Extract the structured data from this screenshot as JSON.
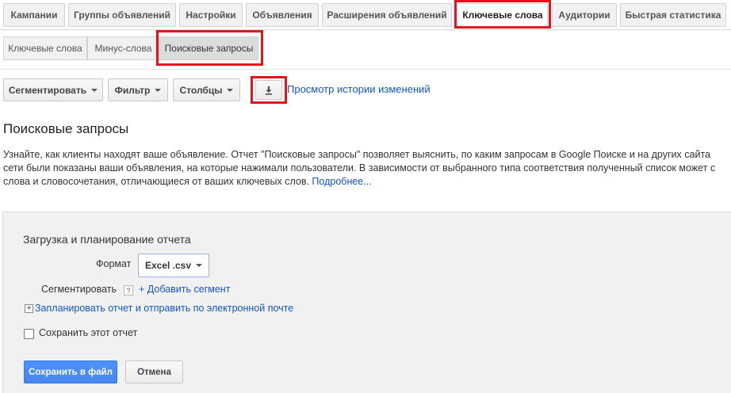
{
  "tabs": [
    {
      "label": "Кампании"
    },
    {
      "label": "Группы объявлений"
    },
    {
      "label": "Настройки"
    },
    {
      "label": "Объявления"
    },
    {
      "label": "Расширения объявлений"
    },
    {
      "label": "Ключевые слова",
      "active": true
    },
    {
      "label": "Аудитории"
    },
    {
      "label": "Быстрая статистика"
    }
  ],
  "subtabs": [
    {
      "label": "Ключевые слова"
    },
    {
      "label": "Минус-слова"
    },
    {
      "label": "Поисковые запросы",
      "active": true
    }
  ],
  "toolbar": {
    "segment_label": "Сегментировать",
    "filter_label": "Фильтр",
    "columns_label": "Столбцы",
    "download_icon": "download-icon",
    "history_link": "Просмотр истории изменений"
  },
  "page": {
    "title": "Поисковые запросы",
    "description_lines": [
      "Узнайте, как клиенты находят ваше объявление. Отчет \"Поисковые запросы\" позволяет выяснить, по каким запросам в Google Поиске и на других сайта",
      "сети были показаны ваши объявления, на которые нажимали пользователи. В зависимости от выбранного типа соответствия полученный список может с",
      "слова и словосочетания, отличающиеся от ваших ключевых слов."
    ],
    "more_link": "Подробнее..."
  },
  "report": {
    "title": "Загрузка и планирование отчета",
    "format_label": "Формат",
    "format_value": "Excel .csv",
    "segment_label": "Сегментировать",
    "help_glyph": "?",
    "add_segment": "+ Добавить сегмент",
    "expand_glyph": "+",
    "schedule_link": "Запланировать отчет и отправить по электронной почте",
    "save_report_label": "Сохранить этот отчет",
    "save_report_checked": false,
    "save_button": "Сохранить в файл",
    "cancel_button": "Отмена"
  },
  "colors": {
    "highlight": "#e4141e",
    "link": "#1155cc",
    "primary_button": "#4d90fe"
  }
}
